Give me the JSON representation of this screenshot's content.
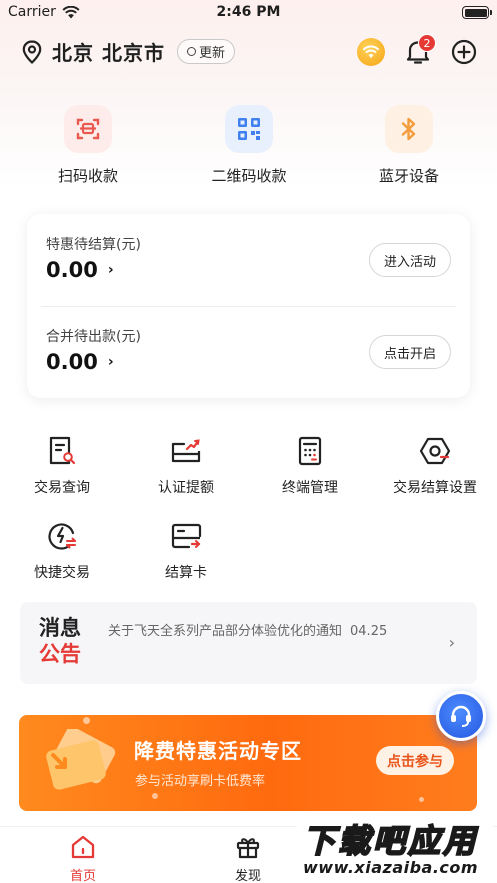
{
  "status_bar": {
    "carrier": "Carrier",
    "time": "2:46 PM"
  },
  "header": {
    "location": "北京 北京市",
    "update_label": "更新",
    "notification_count": "2"
  },
  "quick_actions": [
    {
      "label": "扫码收款",
      "icon": "scan-code-icon",
      "color": "#e85a4f"
    },
    {
      "label": "二维码收款",
      "icon": "qr-code-icon",
      "color": "#3f7ff0"
    },
    {
      "label": "蓝牙设备",
      "icon": "bluetooth-icon",
      "color": "#f39c3d"
    }
  ],
  "balance_card": {
    "rows": [
      {
        "label": "特惠待结算(元)",
        "value": "0.00",
        "button": "进入活动"
      },
      {
        "label": "合并待出款(元)",
        "value": "0.00",
        "button": "点击开启"
      }
    ]
  },
  "functions": [
    {
      "label": "交易查询",
      "icon": "transaction-query-icon"
    },
    {
      "label": "认证提额",
      "icon": "limit-increase-icon"
    },
    {
      "label": "终端管理",
      "icon": "terminal-manage-icon"
    },
    {
      "label": "交易结算设置",
      "icon": "settlement-settings-icon"
    },
    {
      "label": "快捷交易",
      "icon": "quick-trade-icon"
    },
    {
      "label": "结算卡",
      "icon": "settlement-card-icon"
    }
  ],
  "notice": {
    "title_line1": "消息",
    "title_line2": "公告",
    "text": "关于飞天全系列产品部分体验优化的通知",
    "date": "04.25"
  },
  "banner": {
    "title": "降费特惠活动专区",
    "subtitle": "参与活动享刷卡低费率",
    "button": "点击参与"
  },
  "tabbar": [
    {
      "label": "首页",
      "icon": "home-icon",
      "active": true
    },
    {
      "label": "发现",
      "icon": "gift-icon",
      "active": false
    }
  ],
  "watermark": {
    "title": "下载吧应用",
    "url": "www.xiazaiba.com"
  },
  "colors": {
    "accent": "#e53935",
    "banner": "#ff6a0f",
    "support": "#2f6bf0"
  }
}
